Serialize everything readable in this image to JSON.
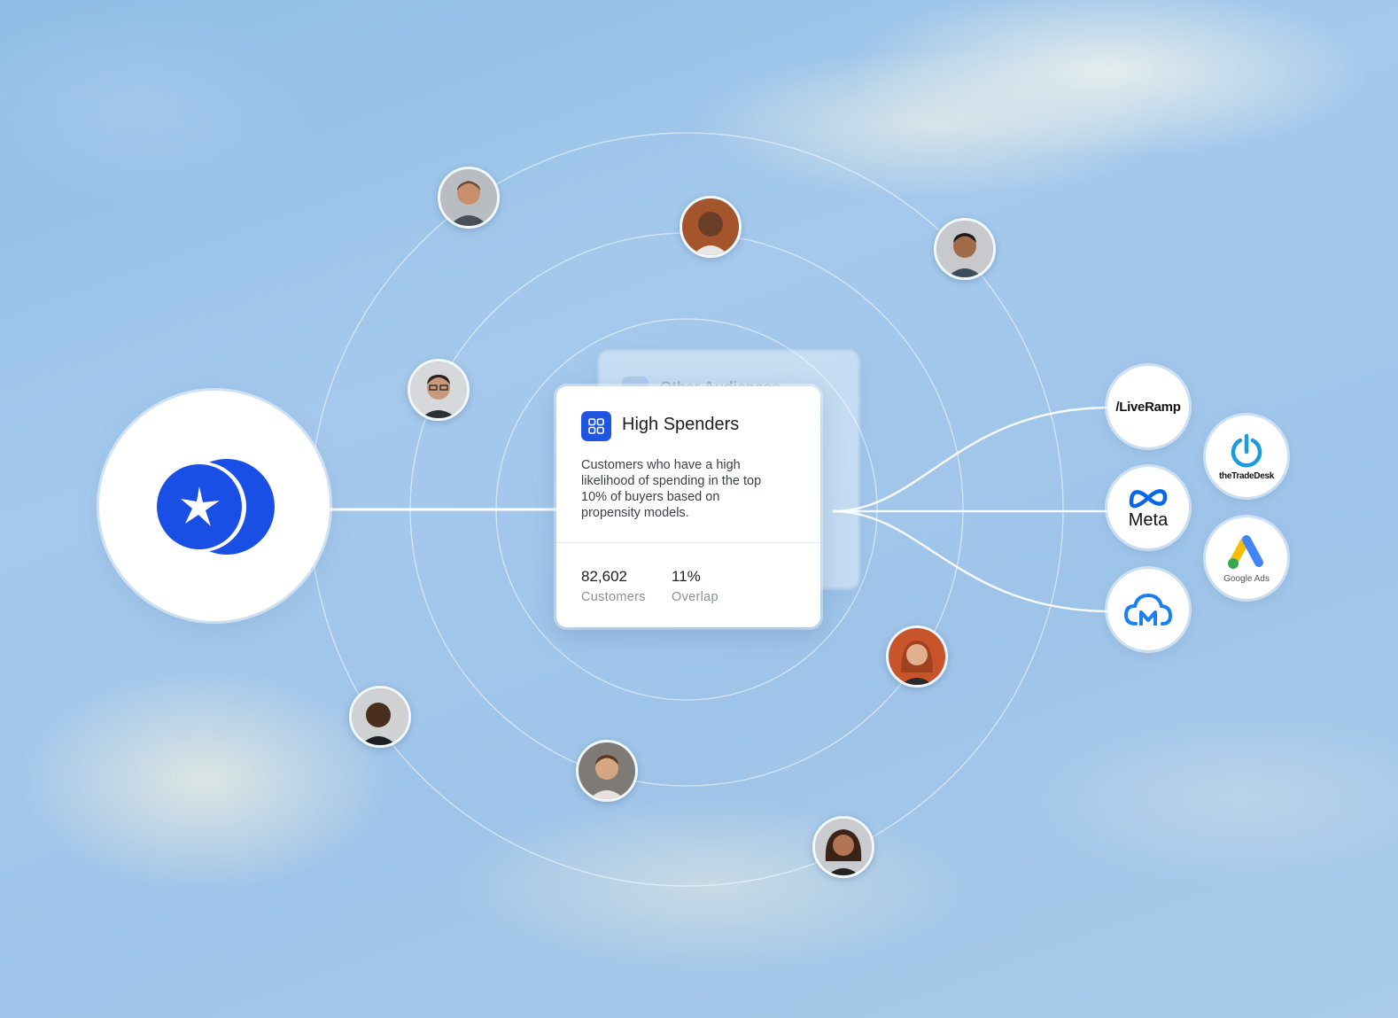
{
  "card": {
    "title": "High Spenders",
    "description": "Customers who have a high likelihood  of spending in the top 10% of buyers based on propensity models.",
    "stats": [
      {
        "value": "82,602",
        "label": "Customers"
      },
      {
        "value": "11%",
        "label": "Overlap"
      }
    ]
  },
  "ghost_card": {
    "title": "Other Audiences"
  },
  "source": {
    "icon": "sparkle-logo-icon",
    "brand_color": "#1a4fe6"
  },
  "avatars": [
    "avatar-1",
    "avatar-2",
    "avatar-3",
    "avatar-4",
    "avatar-5",
    "avatar-6",
    "avatar-7",
    "avatar-8"
  ],
  "destinations": [
    {
      "name": "liveramp",
      "label": "/LiveRamp"
    },
    {
      "name": "thetradedesk",
      "label": "theTradeDesk",
      "color": "#1a9be0"
    },
    {
      "name": "meta",
      "label": "Meta",
      "color": "#0a66e8"
    },
    {
      "name": "google-ads",
      "label": "Google Ads"
    },
    {
      "name": "cloud-m",
      "label": "",
      "color": "#1a7ff0"
    }
  ]
}
